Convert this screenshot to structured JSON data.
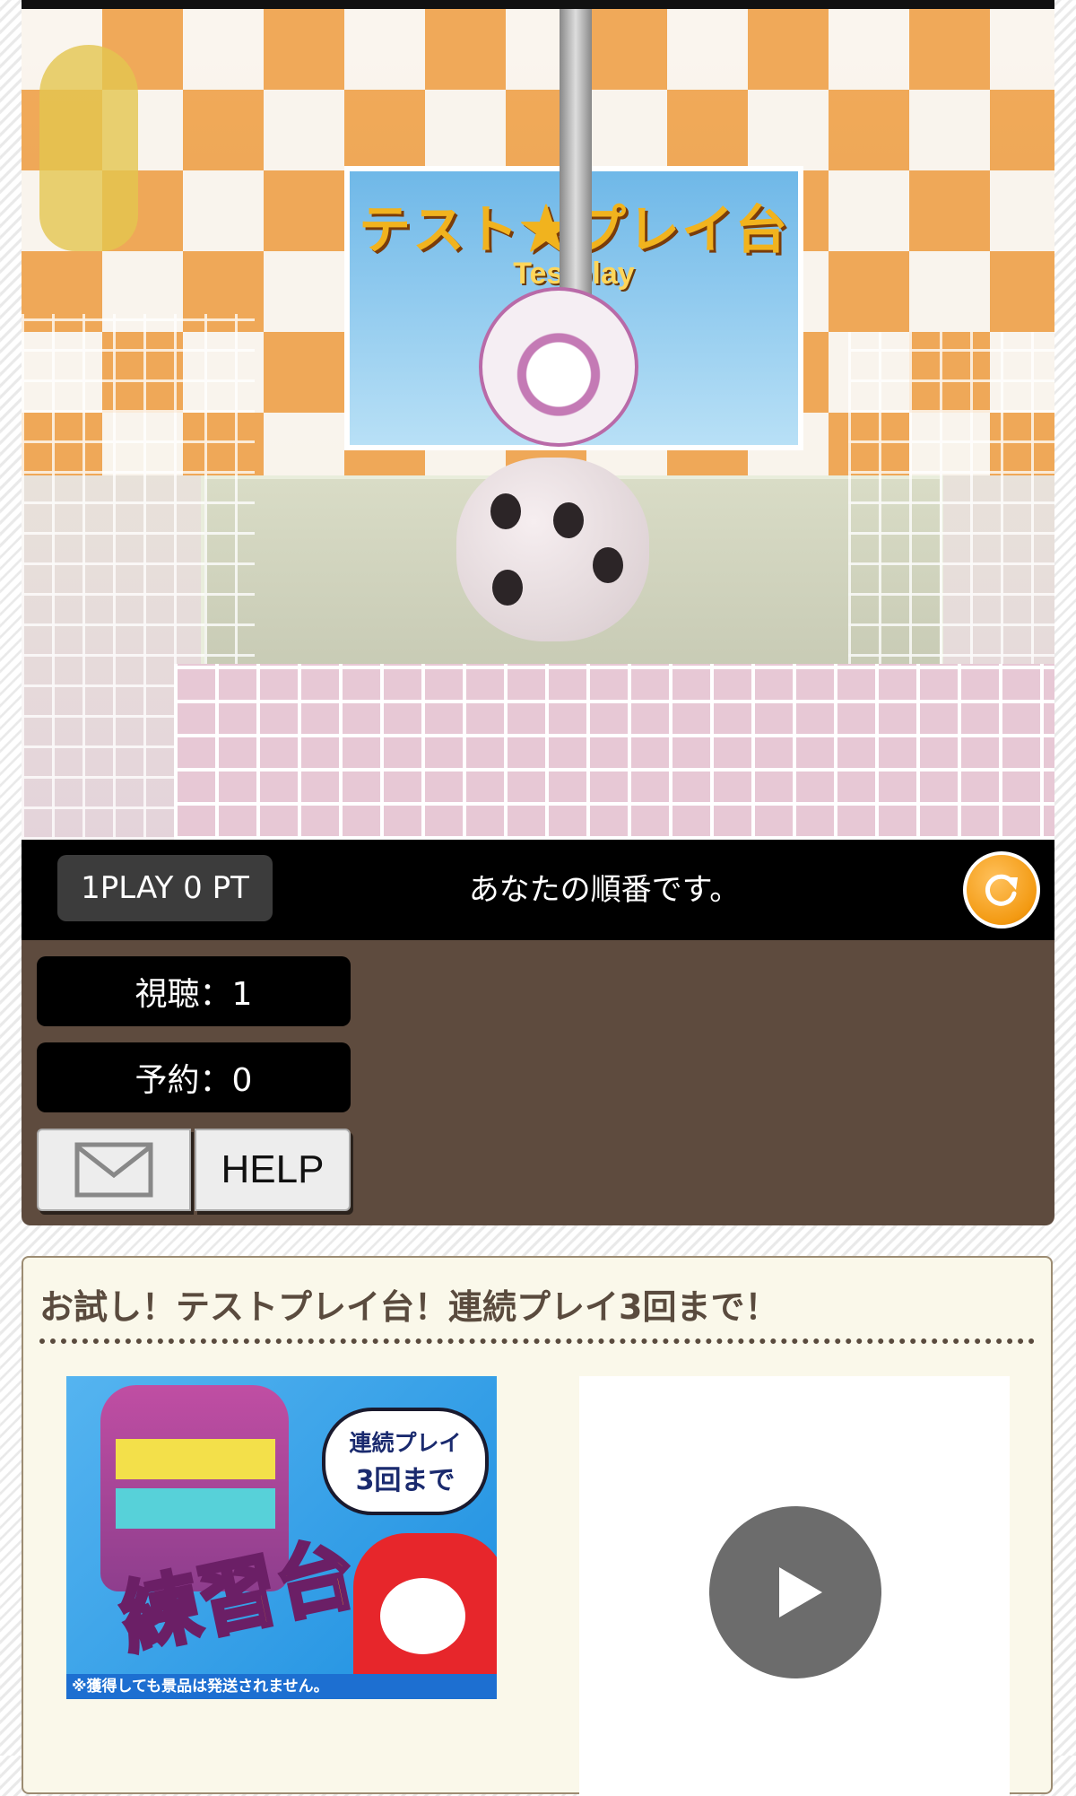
{
  "stream": {
    "sign_title": "テスト★プレイ台",
    "sign_sub": "Testplay"
  },
  "status": {
    "play_cost": "1PLAY 0 PT",
    "turn_message": "あなたの順番です。"
  },
  "stats": {
    "viewers": "視聴：1",
    "reservations": "予約：0"
  },
  "buttons": {
    "help": "HELP",
    "mail_icon": "envelope-icon",
    "reload_icon": "reload-icon"
  },
  "card": {
    "title": "お試し！テストプレイ台！連続プレイ3回まで！",
    "thumb_bubble_l1": "連続プレイ",
    "thumb_bubble_l2": "3回まで",
    "thumb_big": "練習台",
    "thumb_note": "※獲得しても景品は発送されません。",
    "video_icon": "play-icon"
  },
  "colors": {
    "panel": "#5e4b3e",
    "reload_orange": "#f39a12",
    "card_bg": "#faf8ea"
  }
}
